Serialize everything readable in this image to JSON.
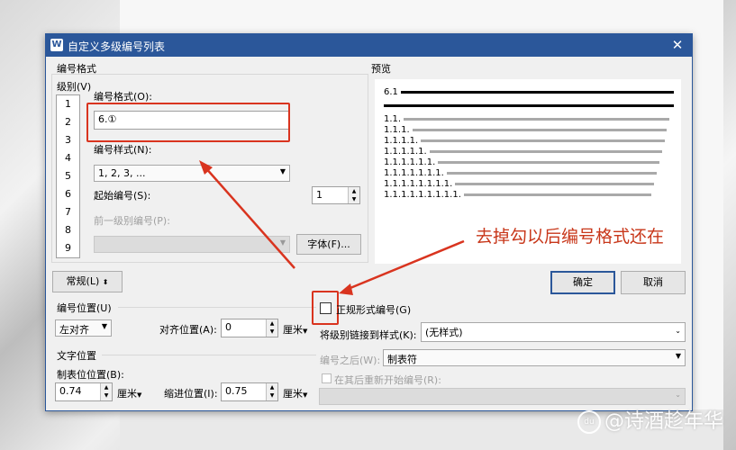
{
  "dialog": {
    "title": "自定义多级编号列表",
    "app_icon_text": "W",
    "close_glyph": "✕"
  },
  "left": {
    "group_number_format": "编号格式",
    "level_label": "级别(V)",
    "levels": [
      "1",
      "2",
      "3",
      "4",
      "5",
      "6",
      "7",
      "8",
      "9"
    ],
    "number_format_label": "编号格式(O):",
    "number_format_value": "6.①",
    "number_style_label": "编号样式(N):",
    "number_style_value": "1, 2, 3, ...",
    "start_at_label": "起始编号(S):",
    "start_at_value": "1",
    "prev_level_label": "前一级别编号(P):",
    "font_button": "字体(F)..."
  },
  "preview": {
    "label": "预览",
    "rows": [
      "6.1",
      "",
      "1.1.",
      "1.1.1.",
      "1.1.1.1.",
      "1.1.1.1.1.",
      "1.1.1.1.1.1.",
      "1.1.1.1.1.1.1.",
      "1.1.1.1.1.1.1.1.",
      "1.1.1.1.1.1.1.1.1."
    ]
  },
  "buttons": {
    "normal": "常规(L)",
    "normal_glyph": "⬍",
    "ok": "确定",
    "cancel": "取消"
  },
  "position": {
    "number_position_label": "编号位置(U)",
    "align_value": "左对齐",
    "align_at_label": "对齐位置(A):",
    "align_at_value": "0",
    "unit": "厘米",
    "text_position_label": "文字位置",
    "tab_position_label": "制表位位置(B):",
    "tab_position_value": "0.74",
    "indent_label": "缩进位置(I):",
    "indent_value": "0.75"
  },
  "right_options": {
    "legal_style_label": "正规形式编号(G)",
    "legal_style_checked": false,
    "link_style_label": "将级别链接到样式(K):",
    "link_style_value": "(无样式)",
    "follow_number_label": "编号之后(W):",
    "follow_number_value": "制表符",
    "restart_label": "在其后重新开始编号(R):"
  },
  "annotation": {
    "text": "去掉勾以后编号格式还在",
    "color": "#c8371a"
  },
  "watermark": {
    "text": "@诗酒趁年华"
  },
  "colors": {
    "title_bar": "#2b579a",
    "highlight_box": "#d9341f"
  }
}
